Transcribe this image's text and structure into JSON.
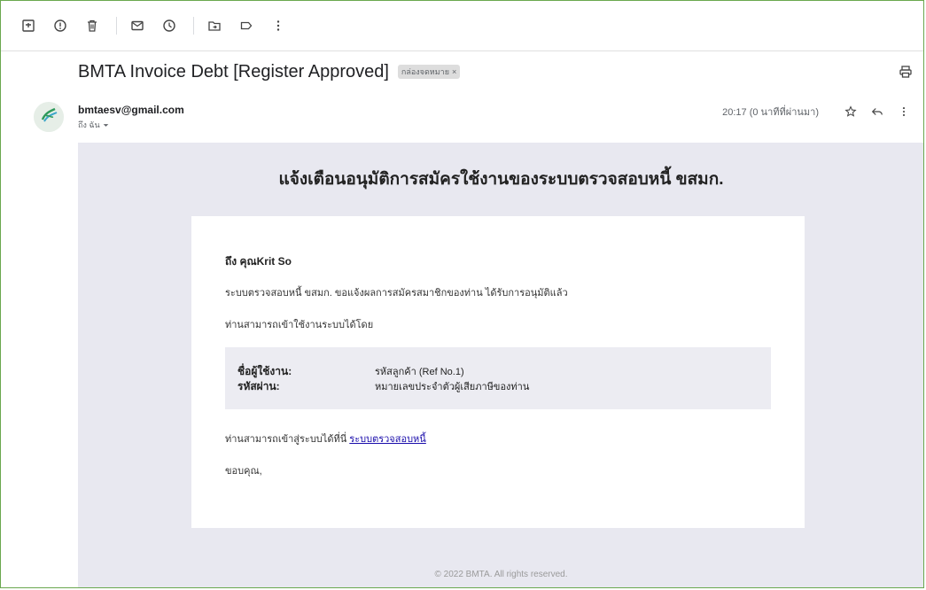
{
  "subject": "BMTA Invoice Debt [Register Approved]",
  "label_chip": "กล่องจดหมาย",
  "label_close": "×",
  "sender": {
    "email": "bmtaesv@gmail.com",
    "to": "ถึง ฉัน",
    "avatar_text": "BMTA"
  },
  "time": "20:17 (0 นาทีที่ผ่านมา)",
  "body": {
    "heading": "แจ้งเตือนอนุมัติการสมัครใช้งานของระบบตรวจสอบหนี้ ขสมก.",
    "greeting": "ถึง คุณKrit So",
    "para1": "ระบบตรวจสอบหนี้ ขสมก. ขอแจ้งผลการสมัครสมาชิกของท่าน ได้รับการอนุมัติแล้ว",
    "para2": "ท่านสามารถเข้าใช้งานระบบได้โดย",
    "credentials": [
      {
        "key": "ชื่อผู้ใช้งาน:",
        "value": "รหัสลูกค้า (Ref No.1)"
      },
      {
        "key": "รหัสผ่าน:",
        "value": "หมายเลขประจำตัวผู้เสียภาษีของท่าน"
      }
    ],
    "para3_prefix": "ท่านสามารถเข้าสู่ระบบได้ที่นี่ ",
    "para3_link": "ระบบตรวจสอบหนี้",
    "thanks": "ขอบคุณ,",
    "footer": "© 2022 BMTA. All rights reserved."
  },
  "colors": {
    "frame_border": "#6aa84f",
    "body_bg": "#e8e8f0",
    "link": "#1a0dab"
  },
  "icons": [
    "archive-icon",
    "report-spam-icon",
    "delete-icon",
    "mark-unread-icon",
    "snooze-icon",
    "move-to-icon",
    "label-icon",
    "more-vert-icon",
    "print-icon",
    "star-icon",
    "reply-icon",
    "more-icon"
  ]
}
